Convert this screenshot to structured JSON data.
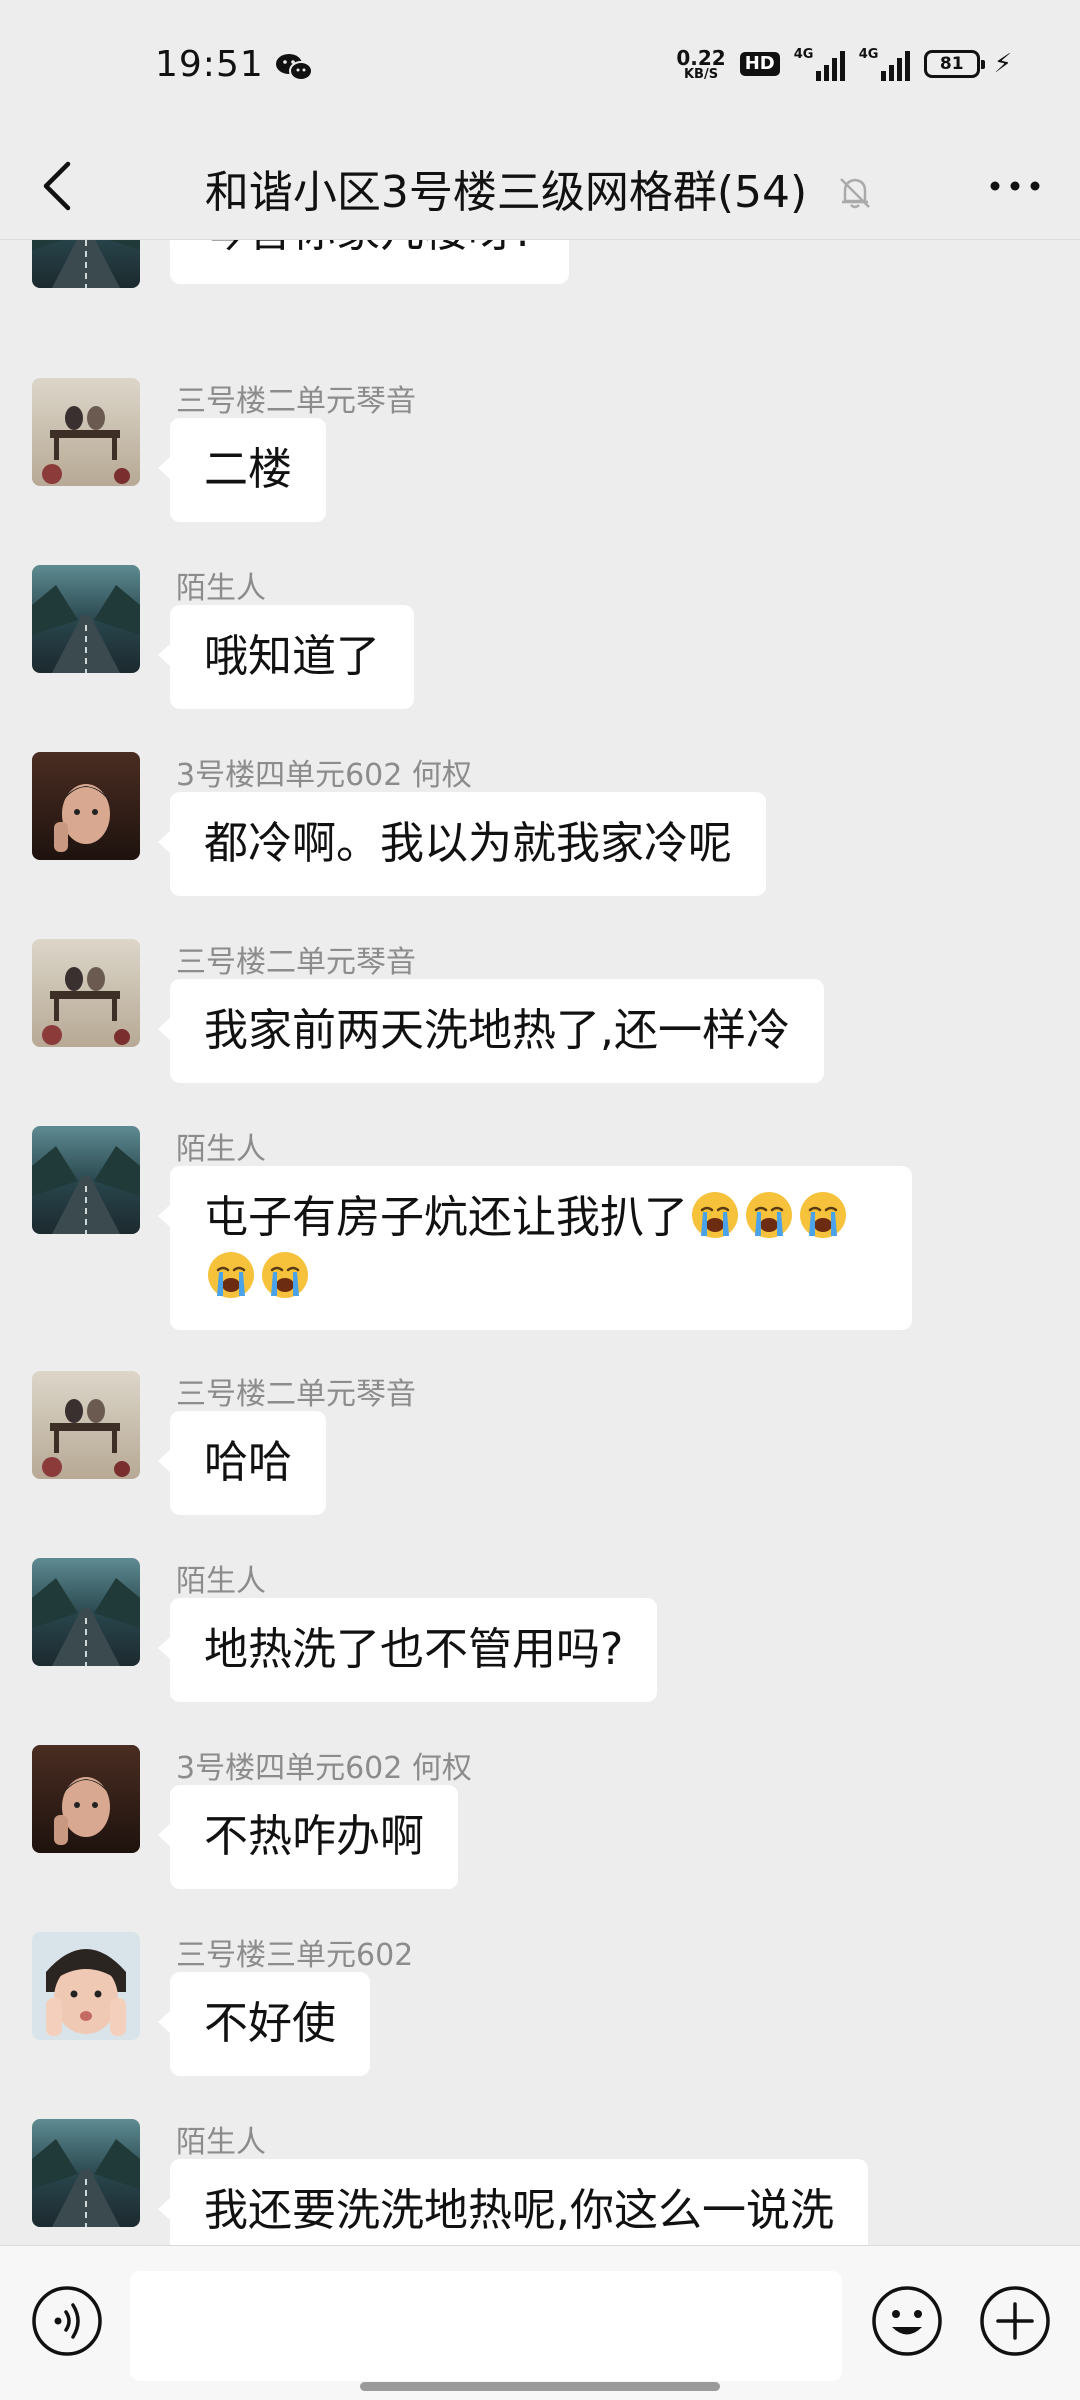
{
  "status_bar": {
    "time": "19:51",
    "net_speed_value": "0.22",
    "net_speed_unit": "KB/S",
    "hd_badge": "HD",
    "sim1_label": "4G",
    "sim2_label": "4G",
    "battery_level": "81",
    "icons": [
      "wechat-icon",
      "hd-icon",
      "signal-icon",
      "signal-icon",
      "battery-icon",
      "charging-icon"
    ]
  },
  "header": {
    "title": "和谐小区3号楼三级网格群(54)",
    "icons": [
      "back-arrow-icon",
      "mute-bell-icon",
      "more-icon"
    ]
  },
  "messages": [
    {
      "sender": "",
      "avatar": "road-avatar",
      "text": "琴音你家几楼呀?"
    },
    {
      "sender": "三号楼二单元琴音",
      "avatar": "bench-avatar",
      "text": "二楼"
    },
    {
      "sender": "陌生人",
      "avatar": "road-avatar",
      "text": "哦知道了"
    },
    {
      "sender": "3号楼四单元602 何权",
      "avatar": "boy-avatar",
      "text": "都冷啊。我以为就我家冷呢"
    },
    {
      "sender": "三号楼二单元琴音",
      "avatar": "bench-avatar",
      "text": "我家前两天洗地热了,还一样冷"
    },
    {
      "sender": "陌生人",
      "avatar": "road-avatar",
      "text": "屯子有房子炕还让我扒了",
      "emoji_count": 5,
      "emoji_name": "loudly-crying-emoji"
    },
    {
      "sender": "三号楼二单元琴音",
      "avatar": "bench-avatar",
      "text": "哈哈"
    },
    {
      "sender": "陌生人",
      "avatar": "road-avatar",
      "text": "地热洗了也不管用吗?"
    },
    {
      "sender": "3号楼四单元602 何权",
      "avatar": "boy-avatar",
      "text": "不热咋办啊"
    },
    {
      "sender": "三号楼三单元602",
      "avatar": "child-avatar",
      "text": "不好使"
    },
    {
      "sender": "陌生人",
      "avatar": "road-avatar",
      "text": "我还要洗洗地热呢,你这么一说洗"
    }
  ],
  "input_bar": {
    "placeholder": "",
    "icons": [
      "voice-icon",
      "emoji-icon",
      "plus-icon"
    ]
  },
  "colors": {
    "background": "#ededed",
    "bubble": "#ffffff",
    "sender_text": "#8c8c8c",
    "input_bar": "#f7f7f7"
  }
}
